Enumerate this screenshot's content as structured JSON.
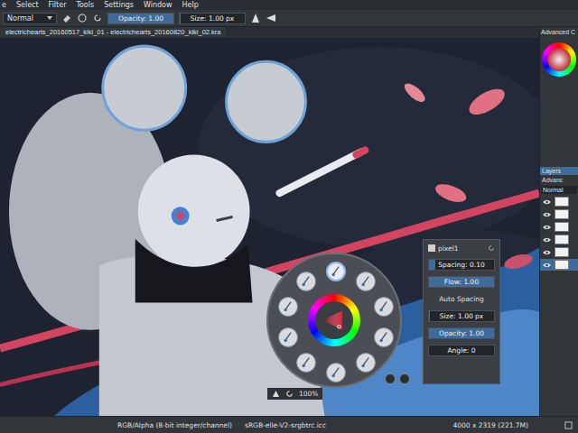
{
  "menu_bar": {
    "items": [
      "e",
      "Select",
      "Filter",
      "Tools",
      "Settings",
      "Window",
      "Help"
    ]
  },
  "toolbar": {
    "blend_mode": "Normal",
    "opacity": {
      "label": "Opacity: 1.00",
      "level": 1
    },
    "size": {
      "label": "Size: 1.00 px",
      "level": 0.01
    }
  },
  "document_tab": {
    "title": "electrichearts_20160517_kiki_01 - electrichearts_20160820_kiki_02.kra"
  },
  "popup_palette": {
    "presets": [
      {
        "selected": true
      },
      {
        "selected": false
      },
      {
        "selected": false
      },
      {
        "selected": false
      },
      {
        "selected": false
      },
      {
        "selected": false
      },
      {
        "selected": false
      },
      {
        "selected": false
      },
      {
        "selected": false
      },
      {
        "selected": false
      }
    ]
  },
  "brush_settings": {
    "preset": "pixel1",
    "fields": [
      {
        "kind": "slider",
        "label": "Spacing: 0.10",
        "level": 0.1
      },
      {
        "kind": "slider",
        "label": "Flow: 1.00",
        "level": 1
      },
      {
        "kind": "button",
        "label": "Auto Spacing",
        "level": 0
      },
      {
        "kind": "slider",
        "label": "Size: 1.00 px",
        "level": 0.01
      },
      {
        "kind": "slider",
        "label": "Opacity: 1.00",
        "level": 1
      },
      {
        "kind": "slider",
        "label": "Angle: 0",
        "level": 0
      }
    ]
  },
  "canvas_bar": {
    "zoom": "100%"
  },
  "color_docker": {
    "title": "Advanced C"
  },
  "layers_panel": {
    "tabs": [
      {
        "label": "Layers",
        "selected": true
      },
      {
        "label": "Advanc",
        "selected": false
      }
    ],
    "blend_mode": "Normal",
    "layers": [
      {
        "visible": true,
        "selected": false
      },
      {
        "visible": true,
        "selected": false
      },
      {
        "visible": true,
        "selected": false
      },
      {
        "visible": true,
        "selected": false
      },
      {
        "visible": true,
        "selected": false
      },
      {
        "visible": true,
        "selected": true
      }
    ]
  },
  "status_bar": {
    "color_space": "RGB/Alpha (8-bit integer/channel)",
    "profile": "sRGB-elle-V2-srgbtrc.icc",
    "dimensions": "4000 x 2319 (221.7M)"
  }
}
